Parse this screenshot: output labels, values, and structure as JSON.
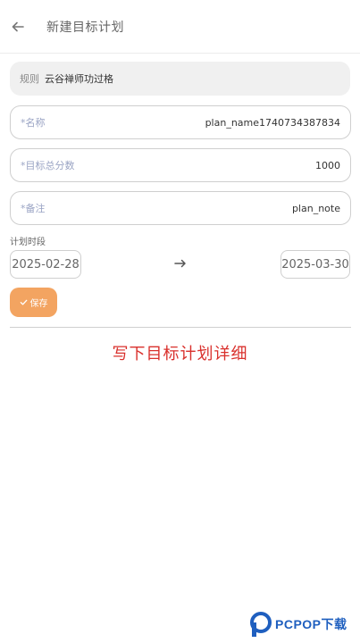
{
  "header": {
    "title": "新建目标计划",
    "back_icon": "arrow-left-icon"
  },
  "rule": {
    "label": "规则",
    "value": "云谷禅师功过格"
  },
  "fields": {
    "name": {
      "label": "*名称",
      "value": "plan_name1740734387834"
    },
    "total_score": {
      "label": "*目标总分数",
      "value": "1000"
    },
    "note": {
      "label": "*备注",
      "value": "plan_note"
    }
  },
  "period": {
    "label": "计划时段",
    "start": "2025-02-28",
    "end": "2025-03-30",
    "arrow_icon": "arrow-right-icon"
  },
  "save_button": {
    "label": "保存",
    "icon": "check-icon"
  },
  "caption": "写下目标计划详细",
  "watermark": {
    "text": "PCPOP下载"
  },
  "colors": {
    "accent": "#f3a461",
    "caption": "#d9302c",
    "label": "#9aa4c4",
    "watermark": "#1f5fbf"
  }
}
